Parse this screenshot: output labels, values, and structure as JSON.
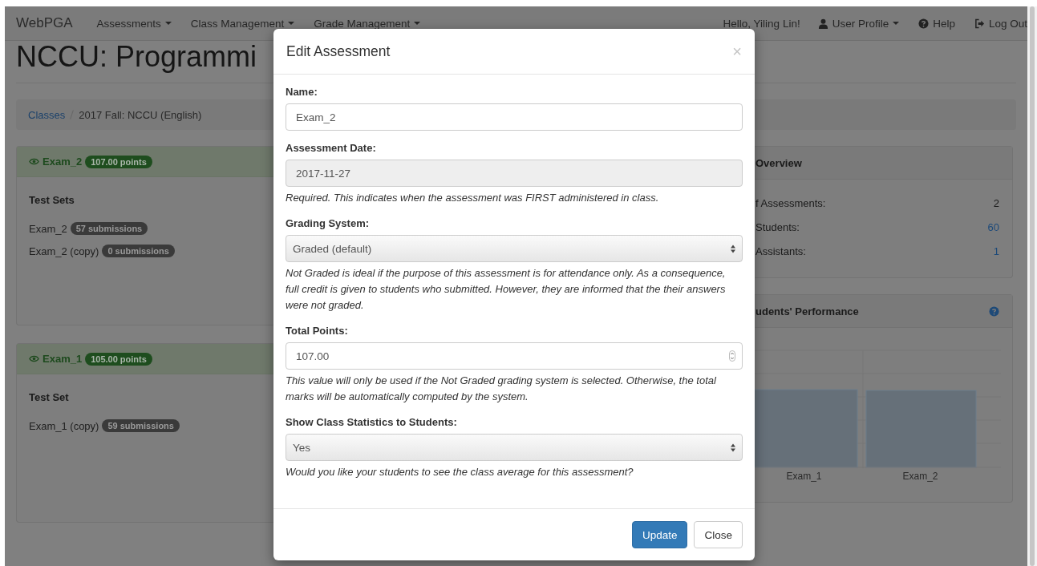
{
  "navbar": {
    "brand": "WebPGA",
    "menus": [
      {
        "label": "Assessments"
      },
      {
        "label": "Class Management"
      },
      {
        "label": "Grade Management"
      }
    ],
    "greeting": "Hello, Yiling Lin!",
    "right_items": [
      {
        "label": "User Profile",
        "kind": "user",
        "dropdown": true
      },
      {
        "label": "Help",
        "kind": "help",
        "dropdown": false
      },
      {
        "label": "Log Out",
        "kind": "logout",
        "dropdown": false
      }
    ]
  },
  "page_title": "NCCU: Programmi",
  "breadcrumb": [
    {
      "label": "Classes",
      "kind": "link"
    },
    {
      "label": "2017 Fall: NCCU (English)",
      "kind": "current"
    }
  ],
  "assessments": [
    {
      "name": "Exam_2",
      "points": "107.00 points",
      "heading": "Test Sets",
      "test_sets": [
        {
          "name": "Exam_2",
          "submissions": "57 submissions"
        },
        {
          "name": "Exam_2 (copy)",
          "submissions": "0 submissions"
        }
      ]
    },
    {
      "name": "Exam_1",
      "points": "105.00 points",
      "heading": "Test Set",
      "test_sets": [
        {
          "name": "Exam_1 (copy)",
          "submissions": "59 submissions"
        }
      ]
    }
  ],
  "overview": {
    "title": "Overview",
    "stats": [
      {
        "label": "f Assessments:",
        "value": "2",
        "link": false
      },
      {
        "label": "Students:",
        "value": "60",
        "link": true
      },
      {
        "label": "Assistants:",
        "value": "1",
        "link": true
      }
    ]
  },
  "performance": {
    "title": "udents' Performance",
    "x_labels": [
      "Exam_1",
      "Exam_2"
    ]
  },
  "modal": {
    "title": "Edit Assessment",
    "close": "×",
    "fields": [
      {
        "kind": "text",
        "label": "Name:",
        "value": "Exam_2",
        "disabled": false
      },
      {
        "kind": "text",
        "label": "Assessment Date:",
        "value": "2017-11-27",
        "disabled": true,
        "help": "Required. This indicates when the assessment was FIRST administered in class."
      },
      {
        "kind": "select",
        "label": "Grading System:",
        "value": "Graded (default)",
        "disabled": false,
        "help": "Not Graded is ideal if the purpose of this assessment is for attendance only. As a consequence, full credit is given to students who submitted. However, they are informed that the their answers were not graded."
      },
      {
        "kind": "number",
        "label": "Total Points:",
        "value": "107.00",
        "disabled": false,
        "help": "This value will only be used if the Not Graded grading system is selected. Otherwise, the total marks will be automatically computed by the system."
      },
      {
        "kind": "select",
        "label": "Show Class Statistics to Students:",
        "value": "Yes",
        "disabled": false,
        "help": "Would you like your students to see the class average for this assessment?"
      }
    ],
    "buttons": [
      {
        "label": "Update",
        "kind": "primary"
      },
      {
        "label": "Close",
        "kind": "default"
      }
    ]
  }
}
